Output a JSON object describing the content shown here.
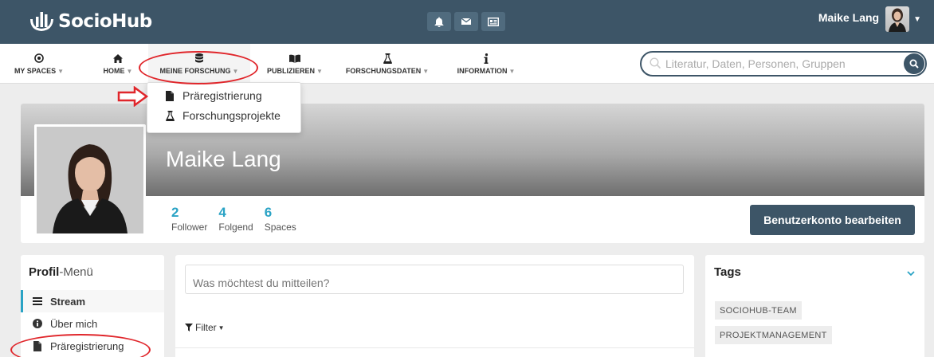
{
  "app": {
    "name": "SocioHub"
  },
  "topbar": {
    "icons": [
      "bell-icon",
      "envelope-icon",
      "newspaper-icon"
    ],
    "user_name": "Maike Lang"
  },
  "nav": {
    "items": [
      {
        "label": "MY SPACES",
        "icon": "dot-circle-icon"
      },
      {
        "label": "HOME",
        "icon": "home-icon"
      },
      {
        "label": "MEINE FORSCHUNG",
        "icon": "database-icon"
      },
      {
        "label": "PUBLIZIEREN",
        "icon": "book-icon"
      },
      {
        "label": "FORSCHUNGSDATEN",
        "icon": "flask-icon"
      },
      {
        "label": "INFORMATION",
        "icon": "info-icon"
      }
    ],
    "search_placeholder": "Literatur, Daten, Personen, Gruppen"
  },
  "dropdown": {
    "items": [
      {
        "label": "Präregistrierung",
        "icon": "file-icon"
      },
      {
        "label": "Forschungsprojekte",
        "icon": "flask-icon"
      }
    ]
  },
  "profile": {
    "name": "Maike Lang",
    "stats": [
      {
        "value": "2",
        "label": "Follower"
      },
      {
        "value": "4",
        "label": "Folgend"
      },
      {
        "value": "6",
        "label": "Spaces"
      }
    ],
    "edit_button": "Benutzerkonto bearbeiten"
  },
  "profile_menu": {
    "title_bold": "Profil",
    "title_rest": "-Menü",
    "items": [
      {
        "label": "Stream",
        "icon": "bars-icon",
        "active": true
      },
      {
        "label": "Über mich",
        "icon": "info-circle-icon"
      },
      {
        "label": "Präregistrierung",
        "icon": "file-icon"
      }
    ]
  },
  "stream": {
    "post_placeholder": "Was möchtest du mitteilen?",
    "filter_label": "Filter"
  },
  "tags": {
    "title": "Tags",
    "items": [
      "SOCIOHUB-TEAM",
      "PROJEKTMANAGEMENT"
    ]
  },
  "colors": {
    "topbar": "#3d5567",
    "accent": "#2aa3c5",
    "annotation": "#e0262b"
  }
}
